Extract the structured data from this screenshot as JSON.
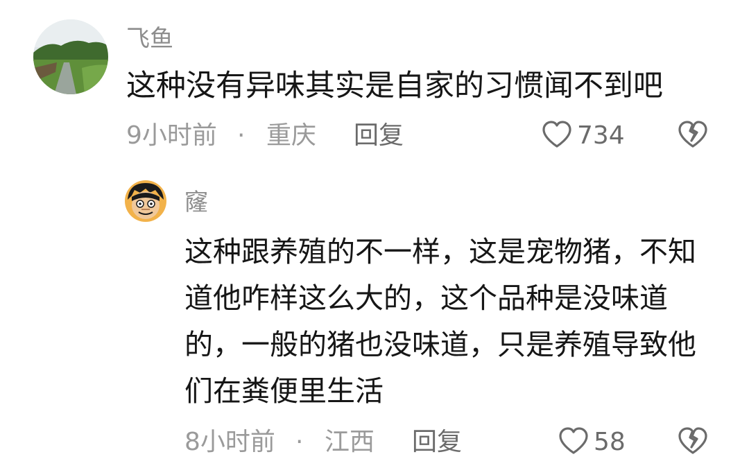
{
  "comment": {
    "username": "飞鱼",
    "text": "这种没有异味其实是自家的习惯闻不到吧",
    "time": "9小时前",
    "separator": "·",
    "location": "重庆",
    "reply_label": "回复",
    "like_count": "734"
  },
  "reply": {
    "username": "窿",
    "text": "这种跟养殖的不一样，这是宠物猪，不知道他咋样这么大的，这个品种是没味道的，一般的猪也没味道，只是养殖导致他们在粪便里生活",
    "time": "8小时前",
    "separator": "·",
    "location": "江西",
    "reply_label": "回复",
    "like_count": "58"
  },
  "icons": {
    "like": "heart-outline-icon",
    "dislike": "broken-heart-icon"
  },
  "colors": {
    "text": "#161616",
    "meta": "#9a9a9a",
    "username": "#8d8d8d",
    "icon": "#6b6b6b"
  }
}
